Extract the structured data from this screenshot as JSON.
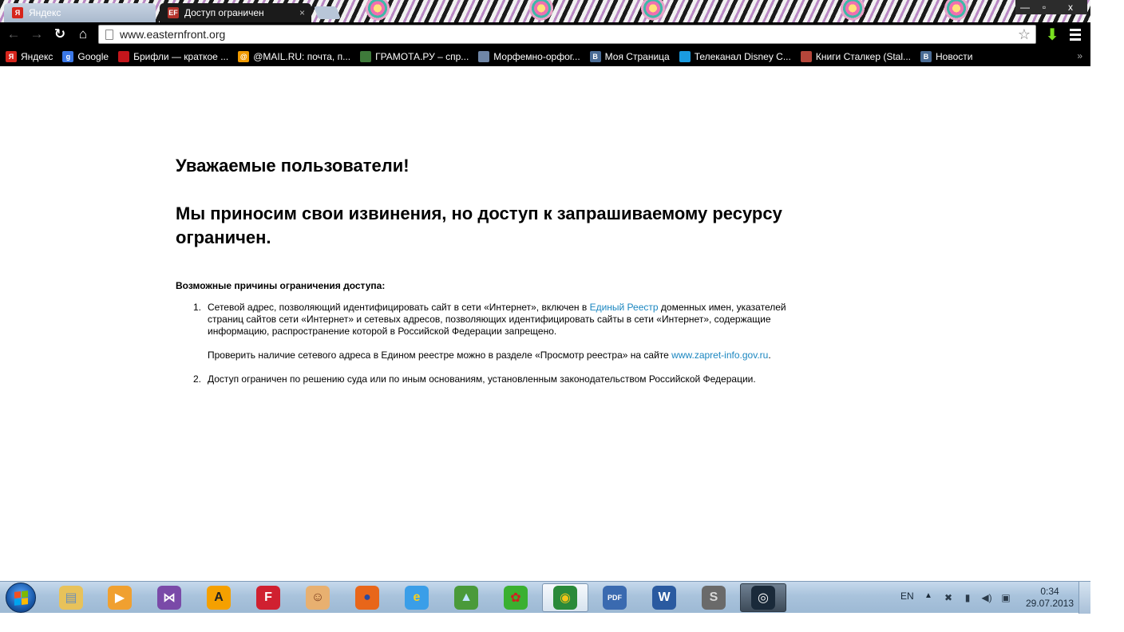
{
  "browser": {
    "tabs": [
      {
        "title": "Яндекс",
        "favicon": "Я",
        "favicon_color": "#d6251c",
        "active": false
      },
      {
        "title": "Доступ ограничен",
        "favicon": "EF",
        "favicon_color": "#b5332b",
        "active": true
      }
    ],
    "tab_close_glyph": "×",
    "window_controls": {
      "minimize": "—",
      "maximize": "▫",
      "close": "x"
    },
    "address": "www.easternfront.org",
    "nav_glyphs": {
      "back": "←",
      "forward": "→",
      "reload": "↻",
      "home": "⌂",
      "star": "☆",
      "download": "⬇"
    },
    "bookmarks": [
      {
        "label": "Яндекс",
        "icon": "yandex-icon",
        "glyph": "Я",
        "color": "#d6251c"
      },
      {
        "label": "Google",
        "icon": "google-icon",
        "glyph": "g",
        "color": "#3b78e7"
      },
      {
        "label": "Брифли — краткое ...",
        "icon": "bookmark-flag-icon",
        "glyph": "",
        "color": "#c4161c"
      },
      {
        "label": "@MAIL.RU: почта, п...",
        "icon": "mailru-icon",
        "glyph": "@",
        "color": "#f09a00"
      },
      {
        "label": "ГРАМОТА.РУ – спр...",
        "icon": "gramota-icon",
        "glyph": "",
        "color": "#3e7a3a"
      },
      {
        "label": "Морфемно-орфог...",
        "icon": "document-icon",
        "glyph": "",
        "color": "#6f86a6"
      },
      {
        "label": "Моя Страница",
        "icon": "vk-icon",
        "glyph": "B",
        "color": "#4a6c96"
      },
      {
        "label": "Телеканал Disney C...",
        "icon": "disney-icon",
        "glyph": "",
        "color": "#1a9be0"
      },
      {
        "label": "Книги Сталкер (Stal...",
        "icon": "books-icon",
        "glyph": "",
        "color": "#b5463a"
      },
      {
        "label": "Новости",
        "icon": "vk-icon",
        "glyph": "B",
        "color": "#4a6c96"
      }
    ],
    "bookmarks_more": "»"
  },
  "page": {
    "heading_1": "Уважаемые пользователи!",
    "heading_2": "Мы приносим свои извинения, но доступ к запрашиваемому ресурсу ограничен.",
    "reasons_title": "Возможные причины ограничения доступа:",
    "reason_1": {
      "number": "1.",
      "text_before_link": "Сетевой адрес, позволяющий идентифицировать сайт в сети «Интернет», включен в ",
      "link": "Единый Реестр",
      "text_after_link": " доменных имен, указателей страниц сайтов сети «Интернет» и сетевых адресов, позволяющих идентифицировать сайты в сети «Интернет», содержащие информацию, распространение которой в Российской Федерации запрещено.",
      "check_text": "Проверить наличие сетевого адреса в Едином реестре можно в разделе «Просмотр реестра» на сайте ",
      "check_link": "www.zapret-info.gov.ru",
      "check_end": "."
    },
    "reason_2": {
      "number": "2.",
      "text": "Доступ ограничен  по решению суда или по иным основаниям, установленным законодательством Российской Федерации."
    },
    "link_color": "#1a86c0"
  },
  "taskbar": {
    "apps": [
      {
        "name": "explorer-icon",
        "glyph": "▤",
        "bg": "#e8c25a",
        "fg": "#6b8fb8"
      },
      {
        "name": "media-player-icon",
        "glyph": "▶",
        "bg": "#f0a030",
        "fg": "#ffffff"
      },
      {
        "name": "visual-studio-icon",
        "glyph": "⋈",
        "bg": "#7a4aa8",
        "fg": "#ffffff"
      },
      {
        "name": "aimp-icon",
        "glyph": "A",
        "bg": "#f5a000",
        "fg": "#222222"
      },
      {
        "name": "flash-icon",
        "glyph": "F",
        "bg": "#d02030",
        "fg": "#ffffff"
      },
      {
        "name": "game-chef-icon",
        "glyph": "☺",
        "bg": "#e8b070",
        "fg": "#7a3a1a"
      },
      {
        "name": "firefox-icon",
        "glyph": "●",
        "bg": "#e8661a",
        "fg": "#2a4aa0"
      },
      {
        "name": "internet-explorer-icon",
        "glyph": "e",
        "bg": "#3a9ee8",
        "fg": "#f5d020"
      },
      {
        "name": "landscape-app-icon",
        "glyph": "▲",
        "bg": "#4a9a3a",
        "fg": "#bfe6ff"
      },
      {
        "name": "icq-icon",
        "glyph": "✿",
        "bg": "#3ab030",
        "fg": "#d02020"
      },
      {
        "name": "chrome-icon",
        "glyph": "◉",
        "bg": "#2a8a3a",
        "fg": "#f5c518",
        "active": true
      },
      {
        "name": "pdf-icon",
        "glyph": "PDF",
        "bg": "#3a6ab0",
        "fg": "#ffffff"
      },
      {
        "name": "word-icon",
        "glyph": "W",
        "bg": "#2a5aa0",
        "fg": "#ffffff"
      },
      {
        "name": "starcraft-icon",
        "glyph": "S",
        "bg": "#6a6a6a",
        "fg": "#d8d8d8"
      },
      {
        "name": "steam-icon",
        "glyph": "◎",
        "bg": "#1a2a3a",
        "fg": "#ffffff",
        "active_dark": true
      }
    ],
    "language": "EN",
    "tray_arrow": "▲",
    "tray_icons": [
      {
        "name": "network-warning-icon",
        "glyph": "✖"
      },
      {
        "name": "signal-bars-icon",
        "glyph": "▮"
      },
      {
        "name": "volume-icon",
        "glyph": "◀)"
      },
      {
        "name": "power-icon",
        "glyph": "▣"
      }
    ],
    "time": "0:34",
    "date": "29.07.2013"
  }
}
